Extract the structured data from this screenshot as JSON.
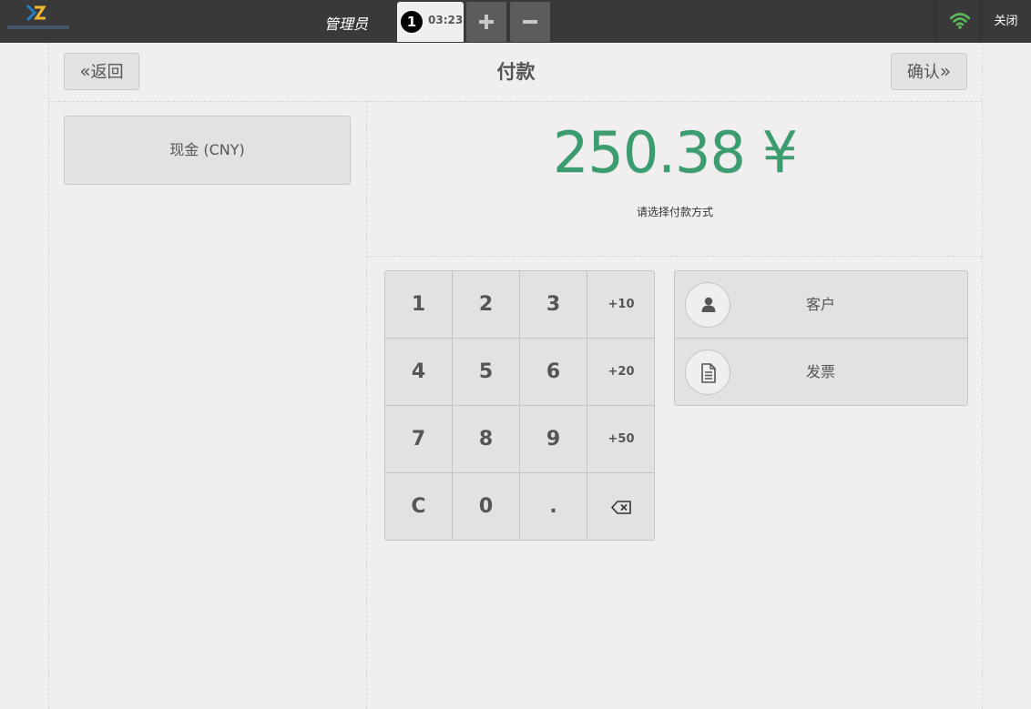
{
  "topbar": {
    "username": "管理员",
    "order": {
      "number": "1",
      "time": "03:23"
    },
    "add_icon": "plus-icon",
    "remove_icon": "minus-icon",
    "wifi_icon": "wifi-icon",
    "wifi_color": "#5cb85c",
    "close_label": "关闭"
  },
  "header": {
    "back_label": "返回",
    "title": "付款",
    "confirm_label": "确认"
  },
  "payment_methods": [
    {
      "label": "现金 (CNY)"
    }
  ],
  "summary": {
    "amount": "250.38 ¥",
    "amount_color": "#3b9c6f",
    "hint": "请选择付款方式"
  },
  "numpad": {
    "keys": [
      "1",
      "2",
      "3",
      "+10",
      "4",
      "5",
      "6",
      "+20",
      "7",
      "8",
      "9",
      "+50",
      "C",
      "0",
      ".",
      "backspace-icon"
    ]
  },
  "side_actions": [
    {
      "label": "客户",
      "icon": "user-icon"
    },
    {
      "label": "发票",
      "icon": "document-icon"
    }
  ]
}
